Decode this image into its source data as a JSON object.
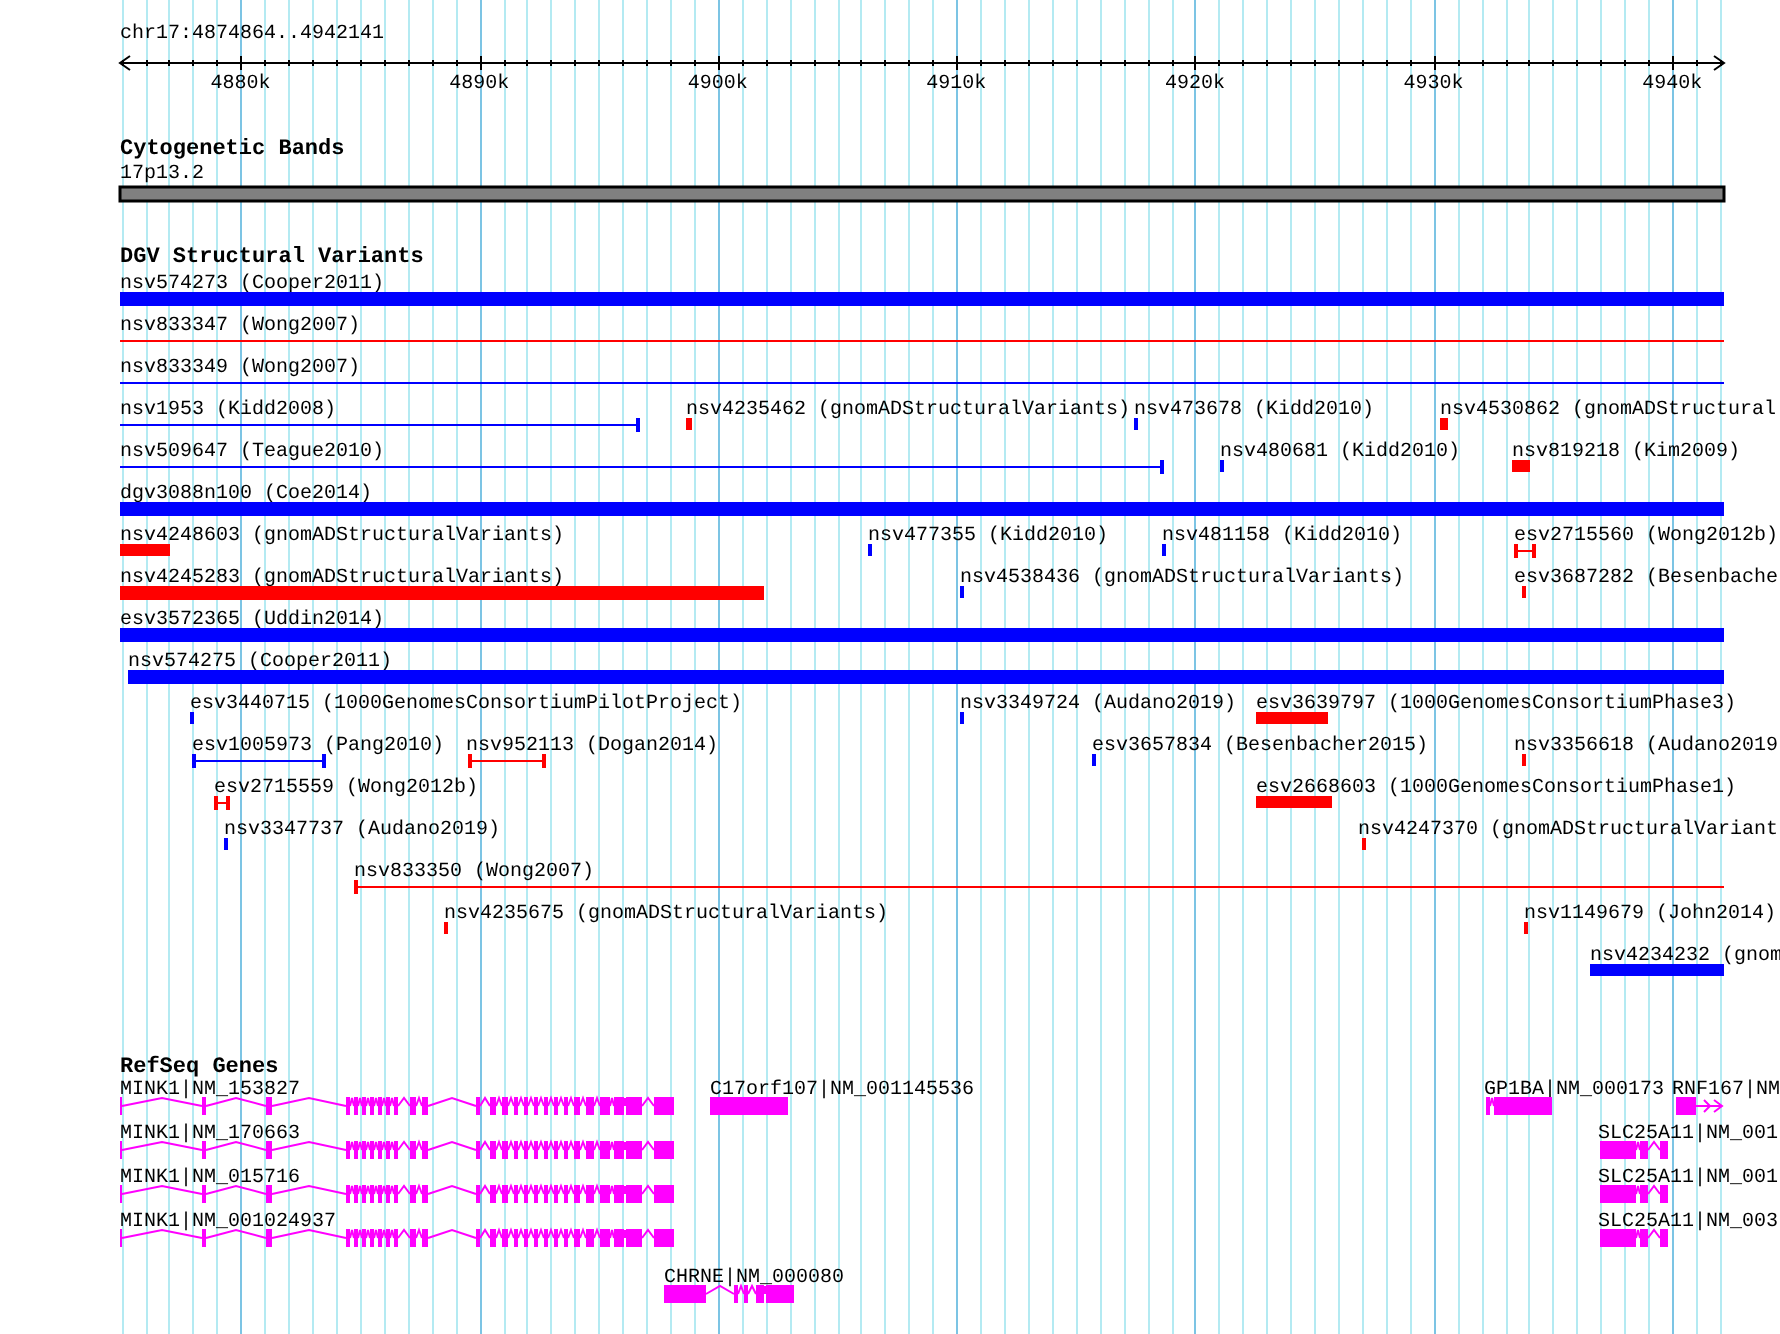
{
  "ruler": {
    "region": "chr17:4874864..4942141",
    "ticks": [
      "4880k",
      "4890k",
      "4900k",
      "4910k",
      "4920k",
      "4930k",
      "4940k"
    ]
  },
  "cytoband": {
    "title": "Cytogenetic Bands",
    "band": "17p13.2"
  },
  "dgv": {
    "title": "DGV Structural Variants",
    "rows": [
      {
        "features": [
          {
            "label": "nsv574273 (Cooper2011)",
            "color": "#0000ff",
            "kind": "bar"
          }
        ]
      },
      {
        "features": [
          {
            "label": "nsv833347 (Wong2007)",
            "color": "#ff0000",
            "kind": "line"
          }
        ]
      },
      {
        "features": [
          {
            "label": "nsv833349 (Wong2007)",
            "color": "#0000ff",
            "kind": "line"
          }
        ]
      },
      {
        "features": [
          {
            "label": "nsv1953 (Kidd2008)",
            "color": "#0000ff",
            "kind": "line"
          },
          {
            "label": "nsv4235462 (gnomADStructuralVariants)",
            "color": "#ff0000",
            "kind": "bar"
          },
          {
            "label": "nsv473678 (Kidd2010)",
            "color": "#0000ff",
            "kind": "bar"
          },
          {
            "label": "nsv4530862 (gnomADStructural",
            "color": "#ff0000",
            "kind": "bar"
          }
        ]
      },
      {
        "features": [
          {
            "label": "nsv509647 (Teague2010)",
            "color": "#0000ff",
            "kind": "line"
          },
          {
            "label": "nsv480681 (Kidd2010)",
            "color": "#0000ff",
            "kind": "bar"
          },
          {
            "label": "nsv819218 (Kim2009)",
            "color": "#ff0000",
            "kind": "bar"
          }
        ]
      },
      {
        "features": [
          {
            "label": "dgv3088n100 (Coe2014)",
            "color": "#0000ff",
            "kind": "bar"
          }
        ]
      },
      {
        "features": [
          {
            "label": "nsv4248603 (gnomADStructuralVariants)",
            "color": "#ff0000",
            "kind": "bar"
          },
          {
            "label": "nsv477355 (Kidd2010)",
            "color": "#0000ff",
            "kind": "bar"
          },
          {
            "label": "nsv481158 (Kidd2010)",
            "color": "#0000ff",
            "kind": "bar"
          },
          {
            "label": "esv2715560 (Wong2012b)",
            "color": "#ff0000",
            "kind": "line"
          }
        ]
      },
      {
        "features": [
          {
            "label": "nsv4245283 (gnomADStructuralVariants)",
            "color": "#ff0000",
            "kind": "bar"
          },
          {
            "label": "nsv4538436 (gnomADStructuralVariants)",
            "color": "#0000ff",
            "kind": "bar"
          },
          {
            "label": "esv3687282 (Besenbache",
            "color": "#ff0000",
            "kind": "bar"
          }
        ]
      },
      {
        "features": [
          {
            "label": "esv3572365 (Uddin2014)",
            "color": "#0000ff",
            "kind": "bar"
          }
        ]
      },
      {
        "features": [
          {
            "label": "nsv574275 (Cooper2011)",
            "color": "#0000ff",
            "kind": "bar"
          }
        ]
      },
      {
        "features": [
          {
            "label": "esv3440715 (1000GenomesConsortiumPilotProject)",
            "color": "#0000ff",
            "kind": "bar"
          },
          {
            "label": "nsv3349724 (Audano2019)",
            "color": "#0000ff",
            "kind": "bar"
          },
          {
            "label": "esv3639797 (1000GenomesConsortiumPhase3)",
            "color": "#ff0000",
            "kind": "bar"
          }
        ]
      },
      {
        "features": [
          {
            "label": "esv1005973 (Pang2010)",
            "color": "#0000ff",
            "kind": "line"
          },
          {
            "label": "nsv952113 (Dogan2014)",
            "color": "#ff0000",
            "kind": "line"
          },
          {
            "label": "esv3657834 (Besenbacher2015)",
            "color": "#0000ff",
            "kind": "bar"
          },
          {
            "label": "nsv3356618 (Audano2019",
            "color": "#ff0000",
            "kind": "bar"
          }
        ]
      },
      {
        "features": [
          {
            "label": "esv2715559 (Wong2012b)",
            "color": "#ff0000",
            "kind": "line"
          },
          {
            "label": "esv2668603 (1000GenomesConsortiumPhase1)",
            "color": "#ff0000",
            "kind": "bar"
          }
        ]
      },
      {
        "features": [
          {
            "label": "nsv3347737 (Audano2019)",
            "color": "#0000ff",
            "kind": "bar"
          },
          {
            "label": "nsv4247370 (gnomADStructuralVariant",
            "color": "#ff0000",
            "kind": "bar"
          }
        ]
      },
      {
        "features": [
          {
            "label": "nsv833350 (Wong2007)",
            "color": "#ff0000",
            "kind": "line"
          }
        ]
      },
      {
        "features": [
          {
            "label": "nsv4235675 (gnomADStructuralVariants)",
            "color": "#ff0000",
            "kind": "bar"
          },
          {
            "label": "nsv1149679 (John2014)",
            "color": "#ff0000",
            "kind": "bar"
          }
        ]
      },
      {
        "features": [
          {
            "label": "nsv4234232 (gnom",
            "color": "#0000ff",
            "kind": "bar"
          }
        ]
      }
    ]
  },
  "refseq": {
    "title": "RefSeq Genes",
    "genes": [
      {
        "label": "MINK1|NM_153827"
      },
      {
        "label": "C17orf107|NM_001145536"
      },
      {
        "label": "GP1BA|NM_000173"
      },
      {
        "label": "RNF167|NM"
      },
      {
        "label": "MINK1|NM_170663"
      },
      {
        "label": "SLC25A11|NM_001"
      },
      {
        "label": "MINK1|NM_015716"
      },
      {
        "label": "SLC25A11|NM_001"
      },
      {
        "label": "MINK1|NM_001024937"
      },
      {
        "label": "SLC25A11|NM_003"
      },
      {
        "label": "CHRNE|NM_000080"
      }
    ]
  }
}
